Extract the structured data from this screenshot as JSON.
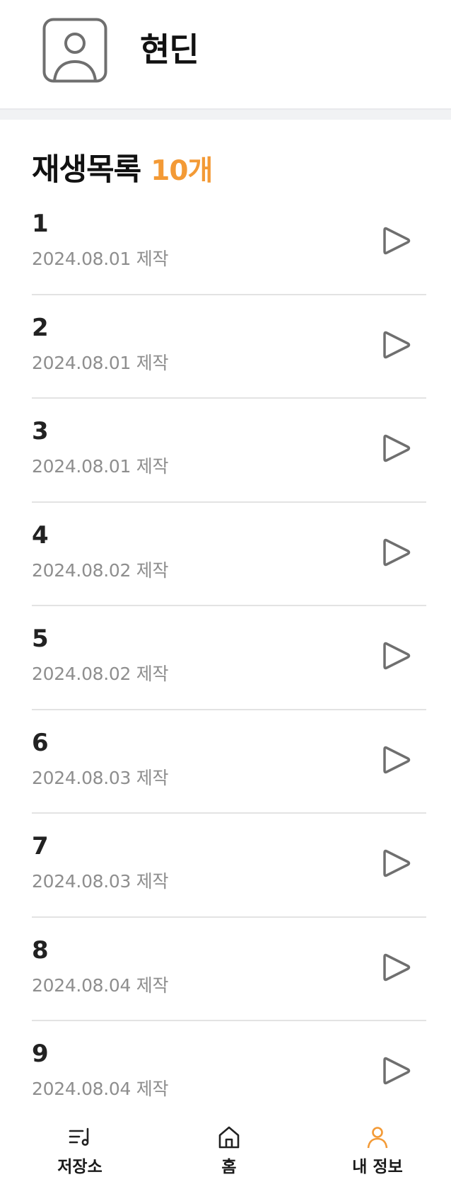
{
  "profile": {
    "avatar_icon": "user-avatar-icon",
    "name": "현딘"
  },
  "playlist_section": {
    "title": "재생목록",
    "count": "10개",
    "accent_color": "#f39a36"
  },
  "playlists": [
    {
      "title": "1",
      "date": "2024.08.01 제작"
    },
    {
      "title": "2",
      "date": "2024.08.01 제작"
    },
    {
      "title": "3",
      "date": "2024.08.01 제작"
    },
    {
      "title": "4",
      "date": "2024.08.02 제작"
    },
    {
      "title": "5",
      "date": "2024.08.02 제작"
    },
    {
      "title": "6",
      "date": "2024.08.03 제작"
    },
    {
      "title": "7",
      "date": "2024.08.03 제작"
    },
    {
      "title": "8",
      "date": "2024.08.04 제작"
    },
    {
      "title": "9",
      "date": "2024.08.04 제작"
    }
  ],
  "tabbar": {
    "tabs": [
      {
        "label": "저장소",
        "icon": "playlist-music-icon",
        "active": false
      },
      {
        "label": "홈",
        "icon": "home-icon",
        "active": false
      },
      {
        "label": "내 정보",
        "icon": "person-icon",
        "active": true
      }
    ],
    "active_color": "#f39a36",
    "inactive_color": "#222222"
  }
}
